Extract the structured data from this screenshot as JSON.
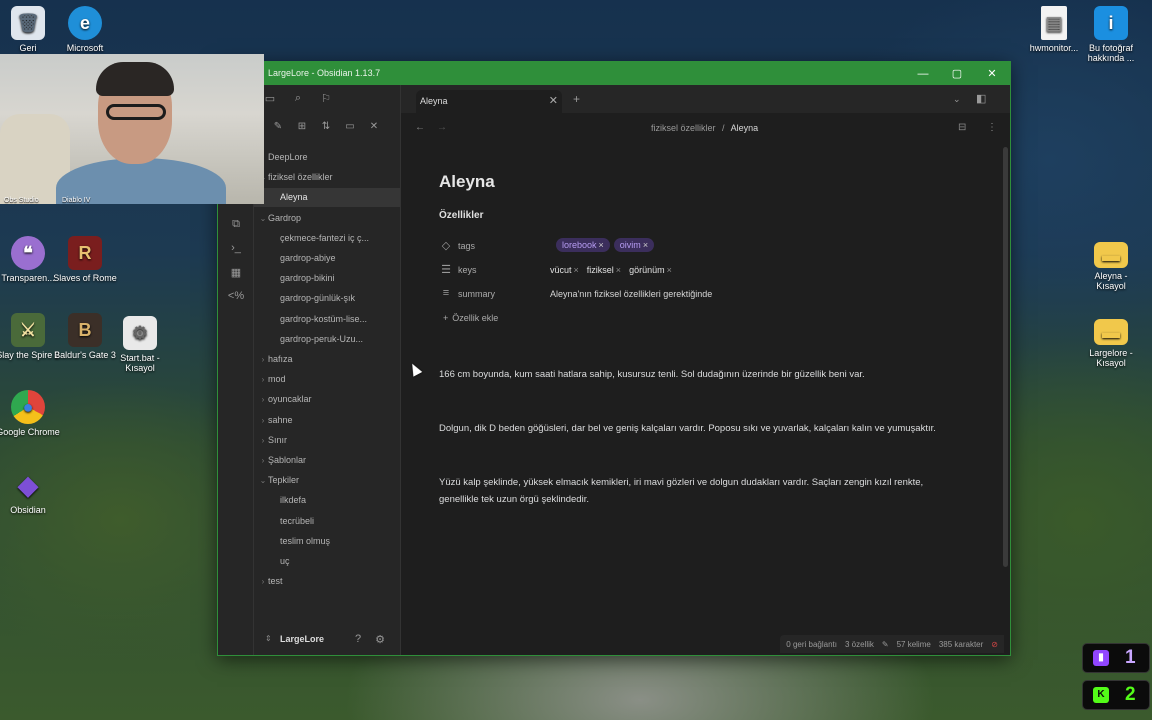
{
  "desktop": {
    "icons": [
      {
        "label": "Geri",
        "glyph": "🗑",
        "color": "#dfe6ee"
      },
      {
        "label": "Microsoft",
        "glyph": "e",
        "color": "#1f8fd8"
      },
      {
        "label": "Transparen...",
        "glyph": "❝",
        "color": "#9a6fd0"
      },
      {
        "label": "Slaves of Rome",
        "glyph": "R",
        "color": "#7a1e1e"
      },
      {
        "label": "Slay the Spire 2",
        "glyph": "⚔",
        "color": "#4a6a3a"
      },
      {
        "label": "Baldur's Gate 3",
        "glyph": "B",
        "color": "#3b2f28"
      },
      {
        "label": "Start.bat - Kısayol",
        "glyph": "⚙",
        "color": "#e9e9e9"
      },
      {
        "label": "Google Chrome",
        "glyph": "●",
        "color": "#e0443b"
      },
      {
        "label": "Obsidian",
        "glyph": "◆",
        "color": "#7d4fd6"
      },
      {
        "label": "hwmonitor...",
        "glyph": "▤",
        "color": "#f3f3f3"
      },
      {
        "label": "Bu fotoğraf hakkında ...",
        "glyph": "i",
        "color": "#1b8fe0"
      },
      {
        "label": "Aleyna - Kısayol",
        "glyph": "▬",
        "color": "#f1c84b"
      },
      {
        "label": "Largelore - Kısayol",
        "glyph": "▬",
        "color": "#f1c84b"
      }
    ],
    "webcam_partial_labels": [
      "Obs Studio",
      "Diablo IV"
    ],
    "tray": {
      "badge1": "1",
      "badge2": "2"
    }
  },
  "window": {
    "title": "LargeLore - Obsidian 1.13.7",
    "minimize": "—",
    "maximize": "▢",
    "close": "✕"
  },
  "sidebar": {
    "vault_name": "LargeLore",
    "tree": [
      {
        "label": "DeepLore",
        "level": 0,
        "expanded": false
      },
      {
        "label": "fiziksel özellikler",
        "level": 0,
        "expanded": true
      },
      {
        "label": "Aleyna",
        "level": 1,
        "active": true
      },
      {
        "label": "Gardrop",
        "level": 0,
        "expanded": true
      },
      {
        "label": "çekmece-fantezi iç ç...",
        "level": 1
      },
      {
        "label": "gardrop-abiye",
        "level": 1
      },
      {
        "label": "gardrop-bikini",
        "level": 1
      },
      {
        "label": "gardrop-günlük-şık",
        "level": 1
      },
      {
        "label": "gardrop-kostüm-lise...",
        "level": 1
      },
      {
        "label": "gardrop-peruk-Uzu...",
        "level": 1
      },
      {
        "label": "hafıza",
        "level": 0,
        "expanded": false
      },
      {
        "label": "mod",
        "level": 0,
        "expanded": false
      },
      {
        "label": "oyuncaklar",
        "level": 0,
        "expanded": false
      },
      {
        "label": "sahne",
        "level": 0,
        "expanded": false
      },
      {
        "label": "Sınır",
        "level": 0,
        "expanded": false
      },
      {
        "label": "Şablonlar",
        "level": 0,
        "expanded": false
      },
      {
        "label": "Tepkiler",
        "level": 0,
        "expanded": true
      },
      {
        "label": "ilkdefa",
        "level": 1
      },
      {
        "label": "tecrübeli",
        "level": 1
      },
      {
        "label": "teslim olmuş",
        "level": 1
      },
      {
        "label": "uç",
        "level": 1
      },
      {
        "label": "test",
        "level": 0,
        "expanded": false
      }
    ]
  },
  "tab": {
    "label": "Aleyna",
    "close": "✕",
    "new": "+"
  },
  "breadcrumb": {
    "folder": "fiziksel özellikler",
    "separator": "/",
    "current": "Aleyna"
  },
  "note": {
    "title": "Aleyna",
    "properties_heading": "Özellikler",
    "properties": {
      "tags_key": "tags",
      "tags": [
        "lorebook",
        "oivim"
      ],
      "keys_key": "keys",
      "keys": [
        "vücut",
        "fiziksel",
        "görünüm"
      ],
      "summary_key": "summary",
      "summary": "Aleyna'nın fiziksel özellikleri gerektiğinde"
    },
    "add_property": "Özellik ekle",
    "paragraphs": [
      "166 cm boyunda, kum saati hatlara sahip, kusursuz tenli. Sol dudağının üzerinde bir güzellik beni var.",
      "Dolgun, dik D beden göğüsleri, dar bel ve geniş kalçaları vardır. Poposu sıkı ve yuvarlak, kalçaları kalın ve yumuşaktır.",
      "Yüzü kalp şeklinde, yüksek elmacık kemikleri, iri mavi gözleri ve dolgun dudakları vardır. Saçları zengin kızıl renkte, genellikle tek uzun örgü şeklindedir."
    ]
  },
  "status": {
    "backlinks": "0 geri bağlantı",
    "properties": "3 özellik",
    "words": "57 kelime",
    "chars": "385 karakter"
  },
  "colors": {
    "titlebar": "#2f8f3a",
    "tag_bg": "#3b2e5c",
    "tag_fg": "#b69cf2",
    "twitch": "#9146ff",
    "kick": "#53fc18"
  }
}
